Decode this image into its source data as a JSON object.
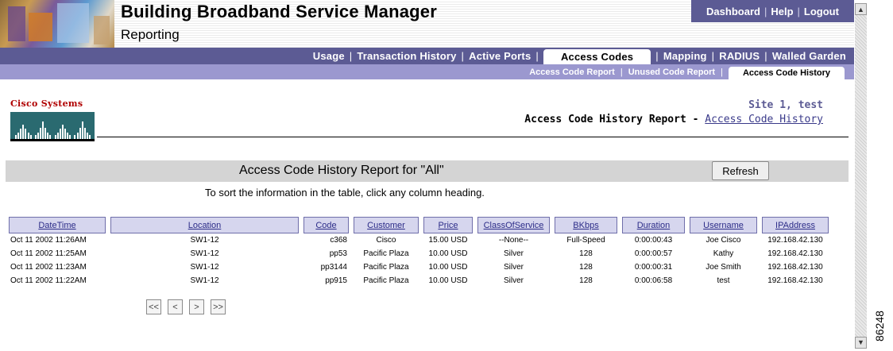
{
  "header": {
    "app_title": "Building Broadband Service Manager",
    "subtitle": "Reporting",
    "top_links": [
      "Dashboard",
      "Help",
      "Logout"
    ]
  },
  "nav_primary": [
    "Usage",
    "Transaction History",
    "Active Ports",
    "Access Codes",
    "Mapping",
    "RADIUS",
    "Walled Garden"
  ],
  "nav_primary_active": "Access Codes",
  "nav_secondary": [
    "Access Code Report",
    "Unused Code Report",
    "Access Code History"
  ],
  "nav_secondary_active": "Access Code History",
  "logo_text": "Cisco Systems",
  "site": {
    "name": "Site 1, test",
    "report_title": "Access Code History Report",
    "report_dash": "-",
    "report_link": "Access Code History"
  },
  "report": {
    "heading": "Access Code History Report for \"All\"",
    "refresh_label": "Refresh",
    "hint": "To sort the information in the table, click any column heading."
  },
  "table": {
    "columns": [
      "DateTime",
      "Location",
      "Code",
      "Customer",
      "Price",
      "ClassOfService",
      "BKbps",
      "Duration",
      "Username",
      "IPAddress"
    ],
    "rows": [
      [
        "Oct 11 2002 11:26AM",
        "SW1-12",
        "c368",
        "Cisco",
        "15.00 USD",
        "--None--",
        "Full-Speed",
        "0:00:00:43",
        "Joe Cisco",
        "192.168.42.130"
      ],
      [
        "Oct 11 2002 11:25AM",
        "SW1-12",
        "pp53",
        "Pacific Plaza",
        "10.00 USD",
        "Silver",
        "128",
        "0:00:00:57",
        "Kathy",
        "192.168.42.130"
      ],
      [
        "Oct 11 2002 11:23AM",
        "SW1-12",
        "pp3144",
        "Pacific Plaza",
        "10.00 USD",
        "Silver",
        "128",
        "0:00:00:31",
        "Joe Smith",
        "192.168.42.130"
      ],
      [
        "Oct 11 2002 11:22AM",
        "SW1-12",
        "pp915",
        "Pacific Plaza",
        "10.00 USD",
        "Silver",
        "128",
        "0:00:06:58",
        "test",
        "192.168.42.130"
      ]
    ]
  },
  "pager": [
    "<<",
    "<",
    ">",
    ">>"
  ],
  "figure_number": "86248",
  "colors": {
    "nav_primary_bg": "#5c5b94",
    "nav_secondary_bg": "#9b98cf",
    "header_cell_bg": "#d6d6ee",
    "logo_red": "#b00000"
  }
}
